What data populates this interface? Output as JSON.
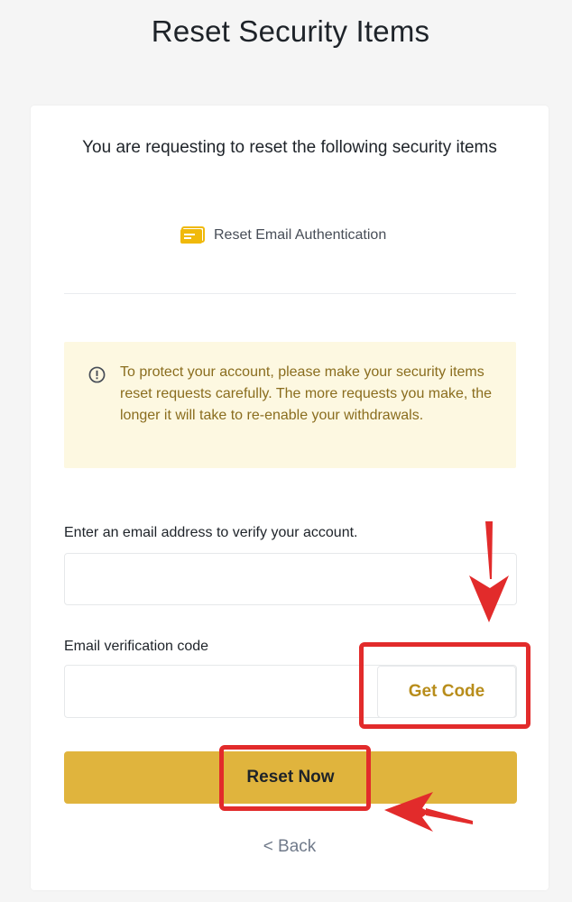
{
  "page": {
    "title": "Reset Security Items"
  },
  "card": {
    "intro": "You are requesting to reset the following security items",
    "reset_item": {
      "label": "Reset Email Authentication",
      "icon": "email-card-icon"
    },
    "notice": {
      "icon": "info-circle-icon",
      "text": "To protect your account, please make your security items reset requests carefully. The more requests you make, the longer it will take to re-enable your withdrawals."
    },
    "email_field": {
      "label": "Enter an email address to verify your account.",
      "value": "",
      "placeholder": ""
    },
    "code_field": {
      "label": "Email verification code",
      "value": "",
      "placeholder": ""
    },
    "get_code_label": "Get Code",
    "reset_label": "Reset Now",
    "back_label": "< Back"
  },
  "colors": {
    "accent": "#e0b43d",
    "accent_text": "#b88d1b",
    "notice_bg": "#fdf8e1",
    "annotation_red": "#e22b2b"
  }
}
